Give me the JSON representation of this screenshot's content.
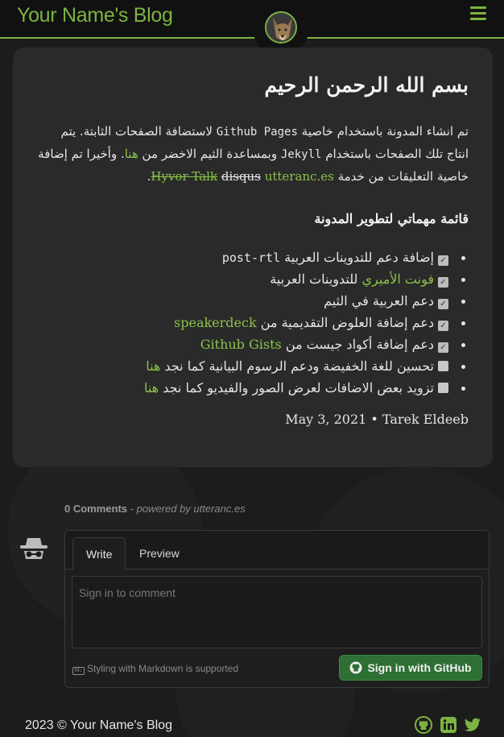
{
  "header": {
    "site_title": "Your Name's Blog"
  },
  "post": {
    "title": "بسم الله الرحمن الرحيم",
    "intro": {
      "p1": "تم انشاء المدونة باستخدام خاصية",
      "github_pages": "Github Pages",
      "p2": "لاستضافة الصفحات الثابتة. يتم انتاج تلك الصفحات باستخدام",
      "jekyll": "Jekyll",
      "p3": "وبمساعدة الثيم الاخضر من",
      "here_link": "هنا",
      "p4": ". وأخيرا تم إضافة خاصية التعليقات من خدمة",
      "strike1": "Hyvor Talk",
      "strike2": "disqus",
      "utterances": "utteranc.es",
      "end": "."
    },
    "todo_title": "قائمة مهماتي لتطوير المدونة",
    "todo": [
      {
        "text": "إضافة دعم للتدوينات العربية",
        "code": "post-rtl",
        "checked": true
      },
      {
        "link": "فونت الأميري",
        "text": "للتدوينات العربية",
        "checked": true
      },
      {
        "text": "دعم العربية في الثيم",
        "checked": true
      },
      {
        "text": "دعم إضافة العلوض التقديمية من",
        "link": "speakerdeck",
        "checked": true
      },
      {
        "text": "دعم إضافة أكواد جيست من",
        "link": "Github Gists",
        "checked": true
      },
      {
        "text": "تحسين للغة الخفيضة ودعم الرسوم البيانية كما نجد",
        "link": "هنا",
        "checked": false
      },
      {
        "text": "تزويد بعض الاضافات لعرض الصور والفيديو كما نجد",
        "link": "هنا",
        "checked": false
      }
    ],
    "meta": "May 3, 2021 • Tarek Eldeeb"
  },
  "comments": {
    "count_label": "0 Comments",
    "powered_by": "- powered by utteranc.es",
    "tab_write": "Write",
    "tab_preview": "Preview",
    "placeholder": "Sign in to comment",
    "markdown_hint": "Styling with Markdown is supported",
    "signin_button": "Sign in with GitHub"
  },
  "footer": {
    "copyright": "2023 © Your Name's Blog"
  },
  "colors": {
    "accent": "#7cb342",
    "button_green": "#2e6f34"
  }
}
